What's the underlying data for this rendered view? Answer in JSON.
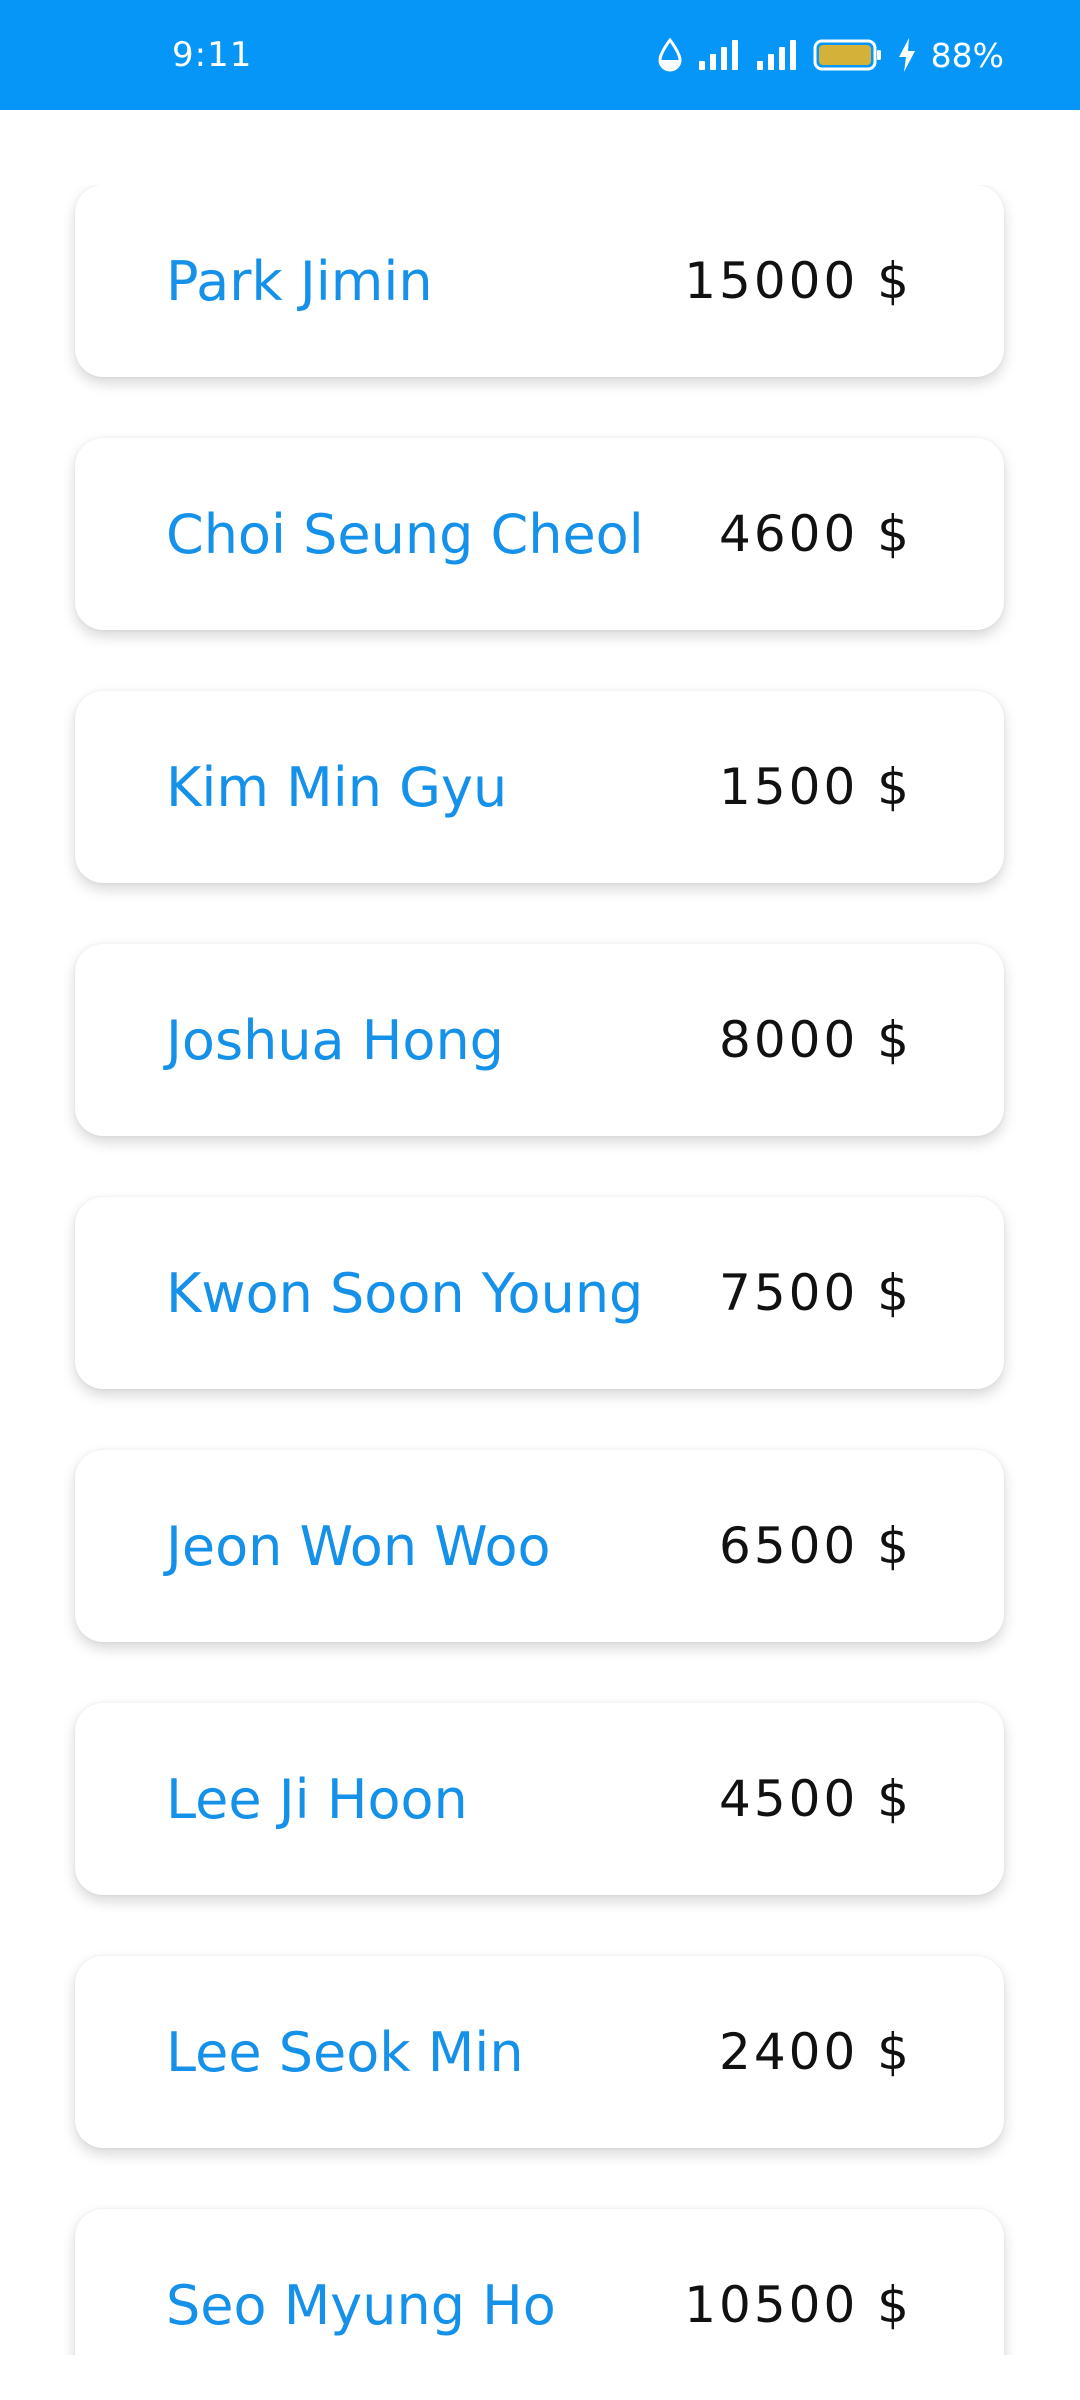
{
  "status_bar": {
    "time": "9:11",
    "battery_percent": "88%",
    "background_color": "#0596f7",
    "battery_fill_color": "#d4b23a",
    "icons": [
      "water-drop-icon",
      "signal-icon",
      "signal-icon",
      "battery-icon",
      "charging-bolt-icon"
    ]
  },
  "theme": {
    "name_color": "#1591e9",
    "amount_color": "#111111"
  },
  "cards": [
    {
      "name": "Park Jimin",
      "amount": "15000 $"
    },
    {
      "name": "Choi Seung Cheol",
      "amount": "4600 $"
    },
    {
      "name": "Kim Min Gyu",
      "amount": "1500 $"
    },
    {
      "name": "Joshua Hong",
      "amount": "8000 $"
    },
    {
      "name": "Kwon Soon Young",
      "amount": "7500 $"
    },
    {
      "name": "Jeon Won Woo",
      "amount": "6500 $"
    },
    {
      "name": "Lee Ji Hoon",
      "amount": "4500 $"
    },
    {
      "name": "Lee Seok Min",
      "amount": "2400 $"
    },
    {
      "name": "Seo Myung Ho",
      "amount": "10500 $"
    }
  ]
}
